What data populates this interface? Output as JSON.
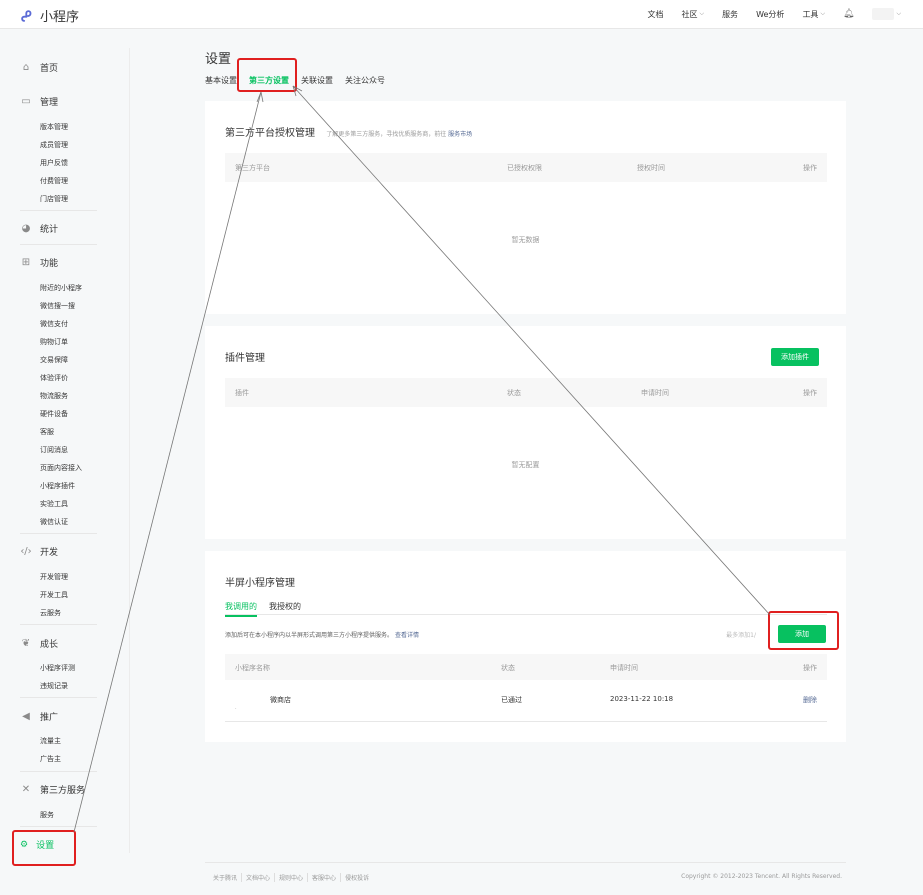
{
  "topbar": {
    "app_name": "小程序",
    "nav": [
      "文档",
      "社区",
      "服务",
      "We分析",
      "工具"
    ]
  },
  "sidebar": {
    "home": "首页",
    "manage": "管理",
    "manage_items": [
      "版本管理",
      "成员管理",
      "用户反馈",
      "付费管理",
      "门店管理"
    ],
    "stats": "统计",
    "features": "功能",
    "feature_items": [
      "附近的小程序",
      "微信搜一搜",
      "微信支付",
      "购物订单",
      "交易保障",
      "体验评价",
      "物流服务",
      "硬件设备",
      "客服",
      "订阅消息",
      "页面内容接入",
      "小程序插件",
      "实验工具",
      "微信认证"
    ],
    "dev": "开发",
    "dev_items": [
      "开发管理",
      "开发工具",
      "云服务"
    ],
    "growth": "成长",
    "growth_items": [
      "小程序评测",
      "违规记录"
    ],
    "promo": "推广",
    "promo_items": [
      "流量主",
      "广告主"
    ],
    "third": "第三方服务",
    "third_items": [
      "服务"
    ],
    "settings": "设置"
  },
  "main": {
    "title": "设置",
    "tabs": [
      "基本设置",
      "第三方设置",
      "关联设置",
      "关注公众号"
    ]
  },
  "card1": {
    "title": "第三方平台授权管理",
    "hint": "了解更多第三方服务，寻找优质服务商，前往",
    "hint_link": "服务市场",
    "cols": [
      "第三方平台",
      "已授权权限",
      "授权时间",
      "操作"
    ],
    "empty": "暂无数据"
  },
  "card2": {
    "title": "插件管理",
    "add_btn": "添加插件",
    "cols": [
      "插件",
      "状态",
      "申请时间",
      "操作"
    ],
    "empty": "暂无配置"
  },
  "card3": {
    "title": "半屏小程序管理",
    "tabs": [
      "我调用的",
      "我授权的"
    ],
    "desc": "添加后可在本小程序内以半屏形式调用第三方小程序提供服务。",
    "desc_link": "查看详情",
    "limit": "最多添加1/",
    "add_btn": "添加",
    "cols": [
      "小程序名称",
      "状态",
      "申请时间",
      "操作"
    ],
    "row": {
      "name": "微商店",
      "status": "已通过",
      "time": "2023-11-22 10:18",
      "action": "删除"
    }
  },
  "footer": {
    "links": [
      "关于腾讯",
      "文档中心",
      "规则中心",
      "客服中心",
      "侵权投诉"
    ],
    "copyright": "Copyright © 2012-2023 Tencent. All Rights Reserved."
  }
}
